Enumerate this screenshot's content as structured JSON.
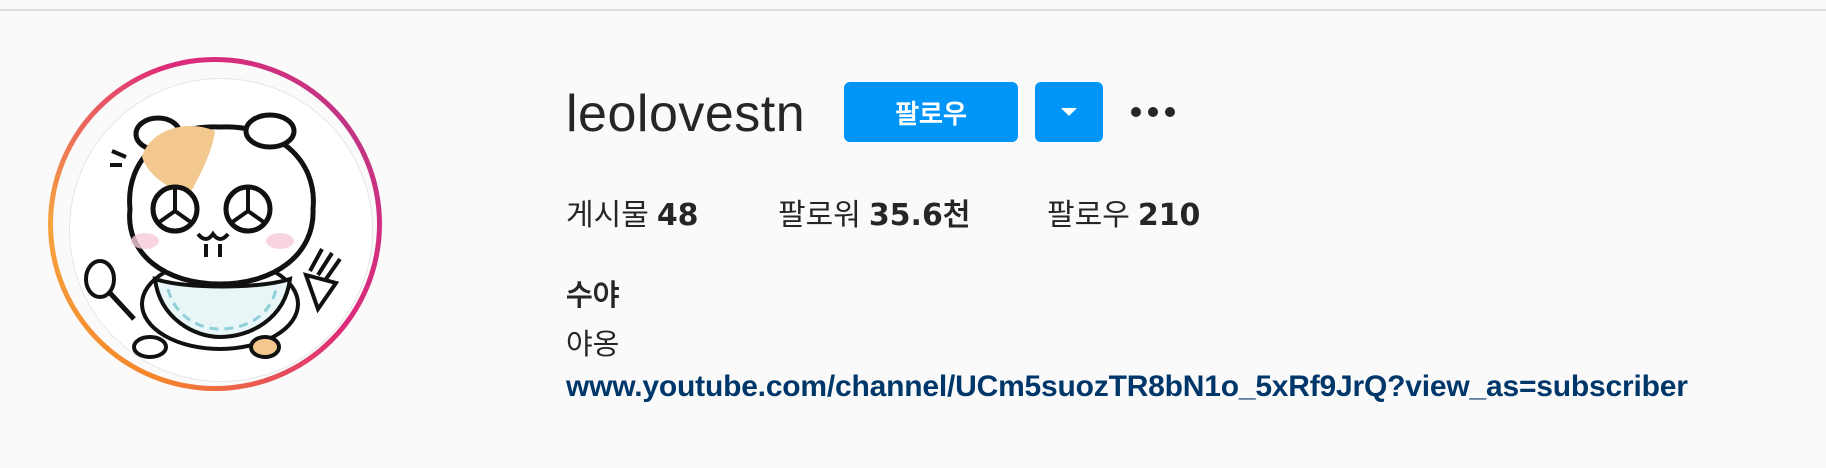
{
  "profile": {
    "username": "leolovestn",
    "follow_label": "팔로우",
    "dropdown_icon": "caret-down-icon",
    "more_icon": "more-options-icon",
    "stats": {
      "posts_label": "게시물",
      "posts_value": "48",
      "followers_label": "팔로워",
      "followers_value": "35.6천",
      "following_label": "팔로우",
      "following_value": "210"
    },
    "full_name": "수야",
    "bio": "야옹",
    "link": "www.youtube.com/channel/UCm5suozTR8bN1o_5xRf9JrQ?view_as=subscriber"
  },
  "colors": {
    "accent": "#0095f6",
    "link": "#00376b",
    "text": "#262626",
    "background": "#fafafa"
  }
}
